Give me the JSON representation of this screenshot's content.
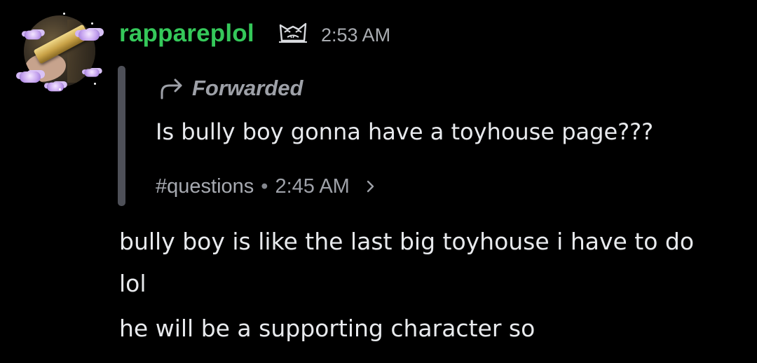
{
  "message": {
    "author": {
      "username": "rappareplol",
      "name_color": "#35c85a",
      "avatar_icon": "avatar-photo",
      "badge_icon": "cat-face-badge-icon"
    },
    "timestamp": "2:53 AM",
    "forwarded": {
      "label": "Forwarded",
      "icon": "forward-arrow-icon",
      "text": "Is bully boy gonna have a toyhouse page???",
      "channel": "#questions",
      "separator": "•",
      "time": "2:45 AM",
      "chevron_icon": "chevron-right-icon"
    },
    "lines": [
      "bully boy is like the last big toyhouse i have to do",
      "lol",
      "he will be a supporting character so"
    ]
  },
  "colors": {
    "background": "#000000",
    "text": "#e8eaed",
    "muted": "#9ea1a8",
    "quote_bar": "#4e5058"
  }
}
